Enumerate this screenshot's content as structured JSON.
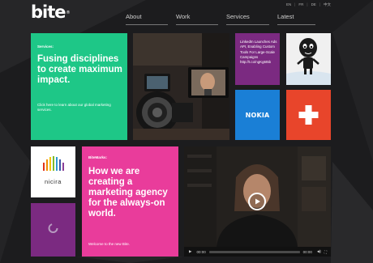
{
  "logo": {
    "text": "bite",
    "mark": "®"
  },
  "nav": {
    "items": [
      "About",
      "Work",
      "Services",
      "Latest"
    ]
  },
  "languages": [
    "EN",
    "FR",
    "DE",
    "中文"
  ],
  "services_tile": {
    "label": "Services:",
    "headline": "Fusing disciplines to create maximum impact.",
    "description": "Click here to learn about our global marketing services."
  },
  "linkedin_tile": {
    "text": "LinkedIn Launches Ads API, Enabling Custom Tools For Large-Scale Campaigns http://t.co/ngKg6t5b"
  },
  "nokia_tile": {
    "logo_text": "NOKIA"
  },
  "nicira_tile": {
    "logo_text": "nicira"
  },
  "bite_tile": {
    "label": "BiteMarks:",
    "headline": "How we are creating a marketing agency for the always-on world.",
    "welcome": "Welcome to the new Bite."
  },
  "video": {
    "current_time": "00:00",
    "duration": "00:00"
  },
  "colors": {
    "background": "#1c1c1e",
    "services": "#1ec787",
    "linkedin": "#7b2a81",
    "nokia": "#1a7fd6",
    "plus": "#e8452b",
    "bitemarks": "#e93c9b"
  }
}
